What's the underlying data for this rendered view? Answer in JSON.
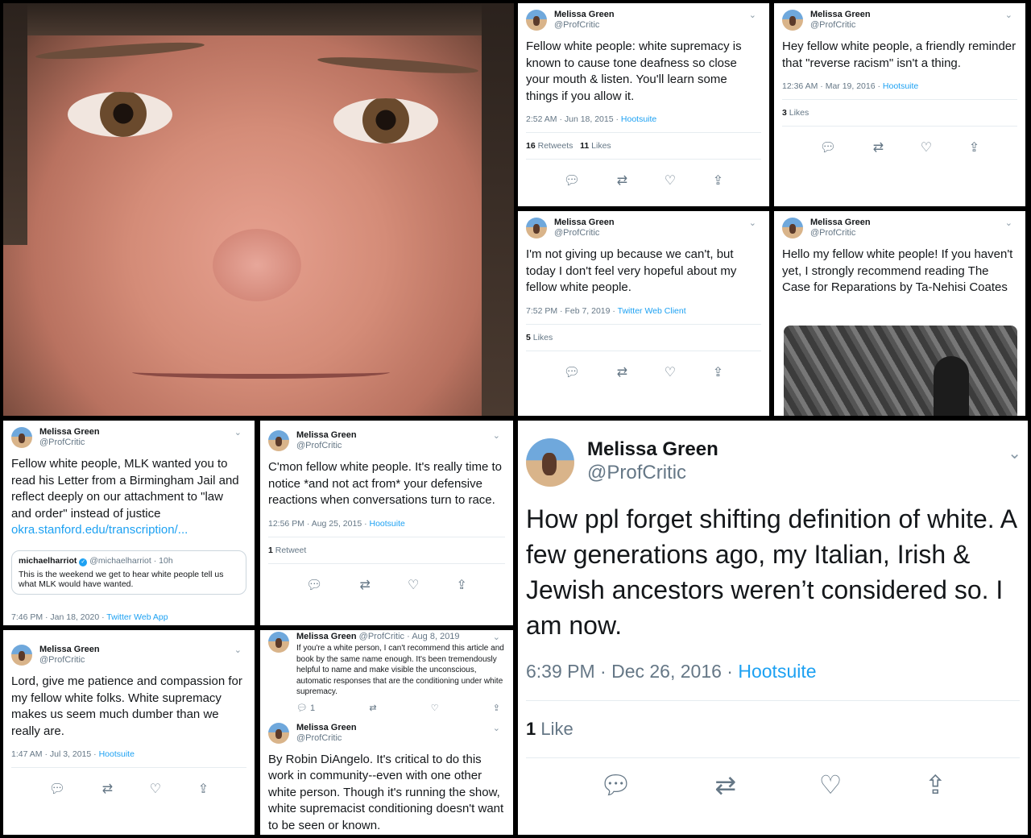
{
  "colors": {
    "link": "#1da1f2",
    "muted": "#657786",
    "text": "#14171a"
  },
  "icons": [
    "reply-icon",
    "retweet-icon",
    "like-icon",
    "share-icon",
    "chevron-down-icon"
  ],
  "tweets": [
    {
      "name": "Melissa Green",
      "handle": "@ProfCritic",
      "text": "Fellow white people: white supremacy is known to cause tone deafness so close your mouth & listen. You'll learn some things if you allow it.",
      "time": "2:52 AM · Jun 18, 2015 · ",
      "source": "Hootsuite",
      "retweets": "16",
      "retweets_label": " Retweets",
      "likes": "11",
      "likes_label": " Likes"
    },
    {
      "name": "Melissa Green",
      "handle": "@ProfCritic",
      "text": "Hey fellow white people, a friendly reminder that \"reverse racism\" isn't a thing.",
      "time": "12:36 AM · Mar 19, 2016 · ",
      "source": "Hootsuite",
      "likes": "3",
      "likes_label": " Likes"
    },
    {
      "name": "Melissa Green",
      "handle": "@ProfCritic",
      "text": "I'm not giving up because we can't, but today I don't feel very hopeful about my fellow white people.",
      "time": "7:52 PM · Feb 7, 2019 · ",
      "source": "Twitter Web Client",
      "likes": "5",
      "likes_label": " Likes"
    },
    {
      "name": "Melissa Green",
      "handle": "@ProfCritic",
      "text": "Hello my fellow white people! If you haven't yet, I strongly recommend reading The Case for Reparations by Ta-Nehisi Coates"
    },
    {
      "name": "Melissa Green",
      "handle": "@ProfCritic",
      "text": "Fellow white people, MLK wanted you to read his Letter from a Birmingham Jail and reflect deeply on our attachment to \"law and order\" instead of justice ",
      "link": "okra.stanford.edu/transcription/...",
      "quote_name": "michaelharriot",
      "quote_handle": "@michaelharriot · 10h",
      "quote_text": "This is the weekend we get to hear white people tell us what MLK would have wanted.",
      "time": "7:46 PM · Jan 18, 2020 · ",
      "source": "Twitter Web App"
    },
    {
      "name": "Melissa Green",
      "handle": "@ProfCritic",
      "text": "C'mon fellow white people. It's really time to notice *and not act from* your defensive reactions when conversations turn to race.",
      "time": "12:56 PM · Aug 25, 2015 · ",
      "source": "Hootsuite",
      "retweets": "1",
      "retweets_label": " Retweet"
    },
    {
      "name": "Melissa Green",
      "handle": "@ProfCritic",
      "text": "Lord, give me patience and compassion for my fellow white folks. White supremacy makes us seem much dumber than we really are.",
      "time": "1:47 AM · Jul 3, 2015 · ",
      "source": "Hootsuite"
    },
    {
      "name": "Melissa Green",
      "handle": "@ProfCritic · Aug 8, 2019",
      "text": "If you're a white person, I can't recommend this article and book by the same name enough. It's been tremendously helpful to name and make visible the unconscious, automatic responses that are the conditioning under white supremacy.",
      "reply_count": "1",
      "name2": "Melissa Green",
      "handle2": "@ProfCritic",
      "text2": "By Robin DiAngelo. It's critical to do this work in community--even with one other white person. Though it's running the show, white supremacist conditioning doesn't want to be seen or known."
    },
    {
      "name": "Melissa Green",
      "handle": "@ProfCritic",
      "text": "How ppl forget shifting definition of white. A few generations ago, my Italian, Irish & Jewish ancestors weren’t considered so. I am now.",
      "time": "6:39 PM · Dec 26, 2016 · ",
      "source": "Hootsuite",
      "likes": "1",
      "likes_label": " Like"
    }
  ]
}
